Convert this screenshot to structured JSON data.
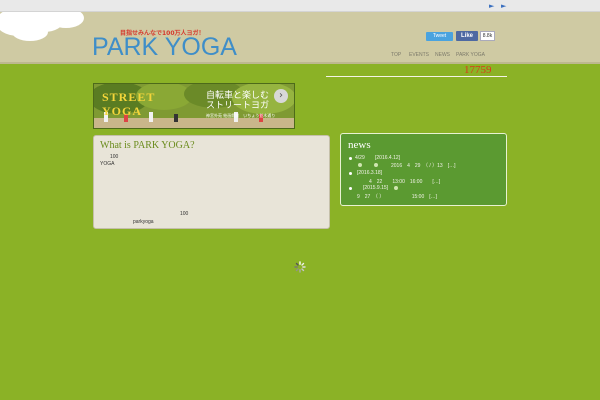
{
  "topbar": {
    "play_symbol": "►"
  },
  "header": {
    "tagline": "目指せみんなで100万人ヨガ！",
    "logo": "PARK YOGA",
    "tweet_label": "Tweet",
    "like_label": "Like",
    "like_count": "8.8k",
    "nav": [
      "TOP",
      "EVENTS",
      "NEWS",
      "PARK YOGA"
    ]
  },
  "counter": "17759",
  "banner": {
    "title_line1": "STREET",
    "title_line2": "YOGA",
    "jp_line1": "自転車と楽しむ",
    "jp_line2": "ストリートヨガ",
    "jp_line3": "神宮外苑 絵画館前　いちょう並木通り",
    "arrow": "›"
  },
  "about": {
    "title": "What is PARK YOGA?",
    "line1": "100",
    "line2": "YOGA",
    "line3": "100",
    "line4": "parkyoga"
  },
  "news": {
    "title": "news",
    "item1_date": "4/29",
    "item1_tag": "[2016.4.12]",
    "item1_detail": "2016　4　29　（ / ）13　[…]",
    "item2_tag": "[2016.3.18]",
    "item2_detail": "4　22　　13:00　16:00　　[…]",
    "item3_tag": "[2015.9.15]",
    "item3_detail": "9　27　（ ）　　　　　　15:00　[…]"
  },
  "colors": {
    "background": "#8bb226",
    "header": "#cfcaa3",
    "logo": "#3f8ec8",
    "counter": "#d93a1a",
    "news_panel": "#5b9a31"
  }
}
